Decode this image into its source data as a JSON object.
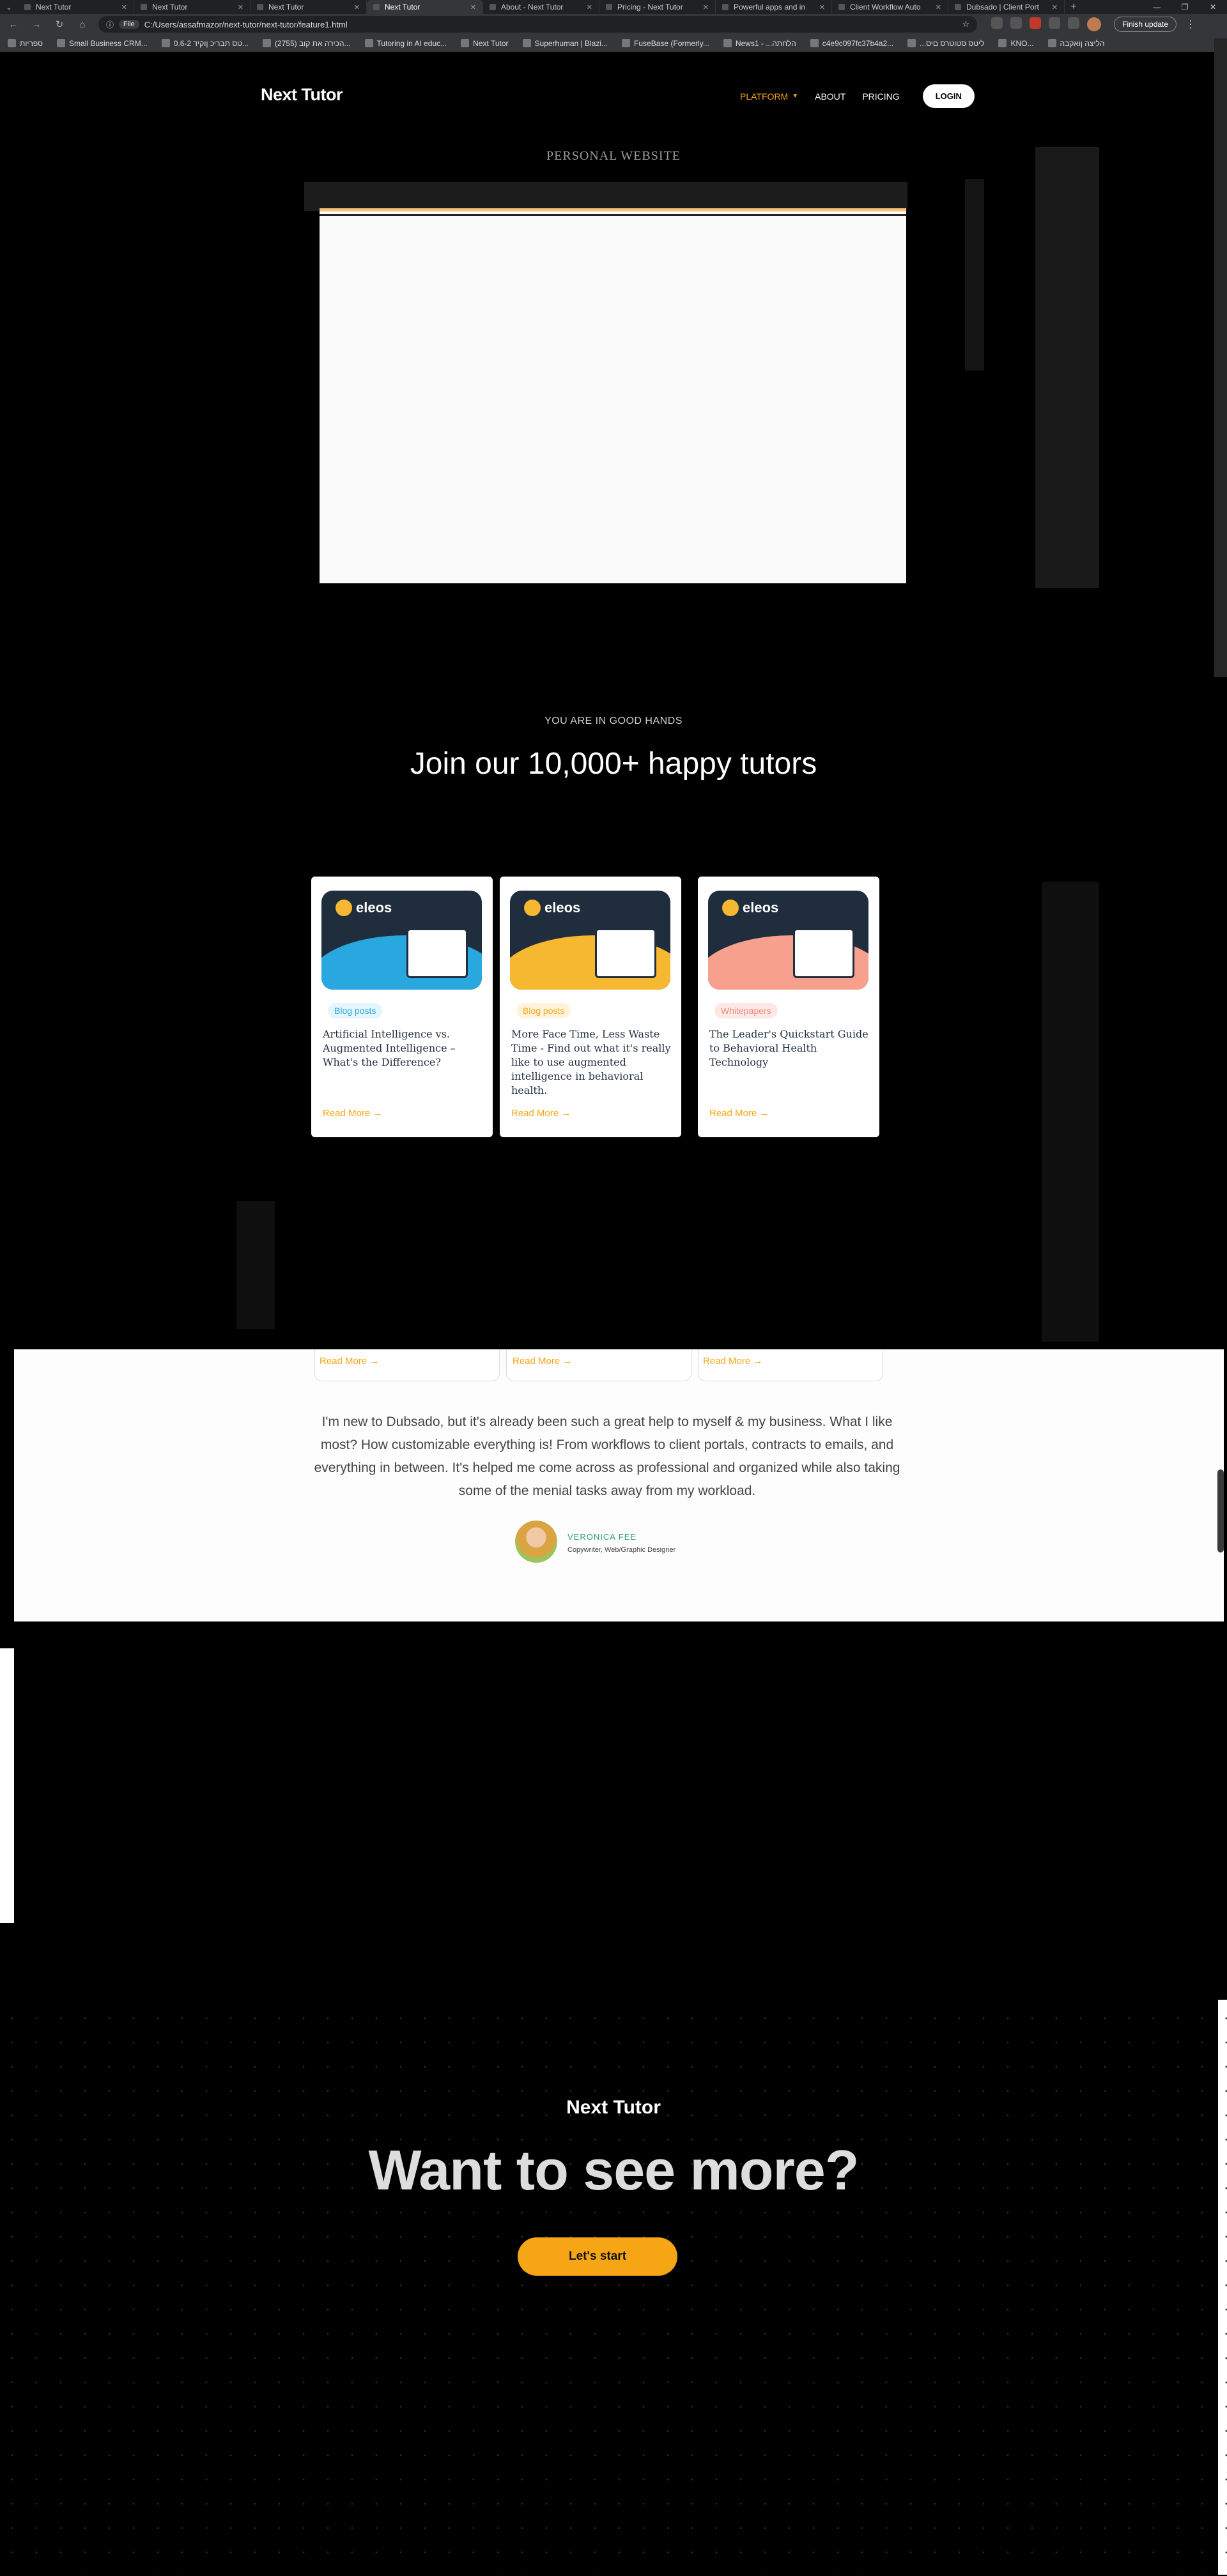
{
  "browser": {
    "tabs": [
      {
        "title": "Next Tutor",
        "active": false
      },
      {
        "title": "Next Tutor",
        "active": false
      },
      {
        "title": "Next Tutor",
        "active": false
      },
      {
        "title": "Next Tutor",
        "active": true
      },
      {
        "title": "About - Next Tutor",
        "active": false
      },
      {
        "title": "Pricing - Next Tutor",
        "active": false
      },
      {
        "title": "Powerful apps and in",
        "active": false
      },
      {
        "title": "Client Workflow Auto",
        "active": false
      },
      {
        "title": "Dubsado | Client Port",
        "active": false
      }
    ],
    "address": {
      "scheme_label": "File",
      "url": "C:/Users/assafmazor/next-tutor/next-tutor/feature1.html"
    },
    "update_label": "Finish update",
    "bookmarks": [
      "ספריות",
      "Small Business CRM...",
      "0.6-2 טס תבריכ ןוקיד...",
      "(2755) הכירה את קוב...",
      "Tutoring in AI educ...",
      "Next Tutor",
      "Superhuman | Blazi...",
      "FuseBase (Formerly...",
      "News1 - ...הלחתה",
      "c4e9c097fc37b4a2...",
      "...ליטס סטוטרס םיס",
      "KNO...",
      "הליצה ןואקבה"
    ]
  },
  "site": {
    "logo": "Next Tutor",
    "nav": {
      "platform": "PLATFORM",
      "about": "ABOUT",
      "pricing": "PRICING",
      "login": "LOGIN"
    },
    "preview_kicker": "PERSONAL WEBSITE",
    "hands": {
      "kicker": "YOU ARE IN GOOD HANDS",
      "title": "Join our 10,000+ happy tutors"
    },
    "cards": [
      {
        "brand": "eleos",
        "badge": "Blog posts",
        "badge_color": "#29a8e0",
        "badge_bg": "#e4f5fd",
        "art_color": "#29a8e0",
        "title": "Artificial Intelligence vs. Augmented Intelligence – What's the Difference?",
        "link": "Read More →",
        "icon": "browser-pencil-icon"
      },
      {
        "brand": "eleos",
        "badge": "Blog posts",
        "badge_color": "#f6a515",
        "badge_bg": "#fff3dc",
        "art_color": "#f6b731",
        "title": "More Face Time, Less Waste Time - Find out what it's really like to use augmented intelligence in behavioral health.",
        "link": "Read More →",
        "icon": "folder-magnifier-icon"
      },
      {
        "brand": "eleos",
        "badge": "Whitepapers",
        "badge_color": "#f08a7e",
        "badge_bg": "#fde8e5",
        "art_color": "#f7a08e",
        "title": "The Leader's Quickstart Guide to Behavioral Health Technology",
        "link": "Read More →",
        "icon": "document-icon"
      }
    ],
    "repeat_links": [
      "Read More →",
      "Read More →",
      "Read More →"
    ],
    "testimonial": {
      "quote": "I'm new to Dubsado, but it's already been such a great help to myself & my business. What I like most? How customizable everything is! From workflows to client portals, contracts to emails, and everything in between. It's helped me come across as professional and organized while also taking some of the menial tasks away from my workload.",
      "name": "VERONICA FEE",
      "role": "Copywriter, Web/Graphic Designer"
    },
    "cta": {
      "logo": "Next Tutor",
      "title": "Want to see more?",
      "button": "Let's start"
    }
  }
}
